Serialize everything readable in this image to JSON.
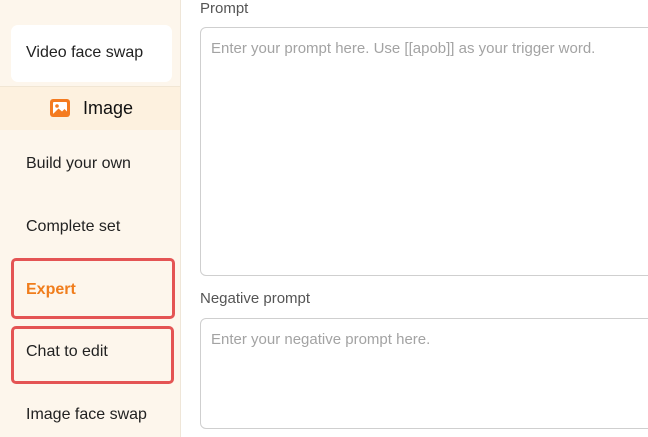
{
  "sidebar": {
    "top_item": {
      "label": "Video face swap"
    },
    "section": {
      "title": "Image",
      "icon": "image-icon",
      "icon_color": "#f47b20"
    },
    "items": [
      {
        "label": "Build your own",
        "active": false
      },
      {
        "label": "Complete set",
        "active": false
      },
      {
        "label": "Expert",
        "active": true
      },
      {
        "label": "Chat to edit",
        "active": false
      },
      {
        "label": "Image face swap",
        "active": false
      }
    ]
  },
  "main": {
    "prompt": {
      "label": "Prompt",
      "placeholder": "Enter your prompt here. Use [[apob]] as your trigger word."
    },
    "negative_prompt": {
      "label": "Negative prompt",
      "placeholder": "Enter your negative prompt here."
    }
  },
  "colors": {
    "accent": "#f07d1c",
    "highlight": "#e45454",
    "sidebar_bg": "#fdf6ec",
    "section_bg": "#fdf1df"
  }
}
